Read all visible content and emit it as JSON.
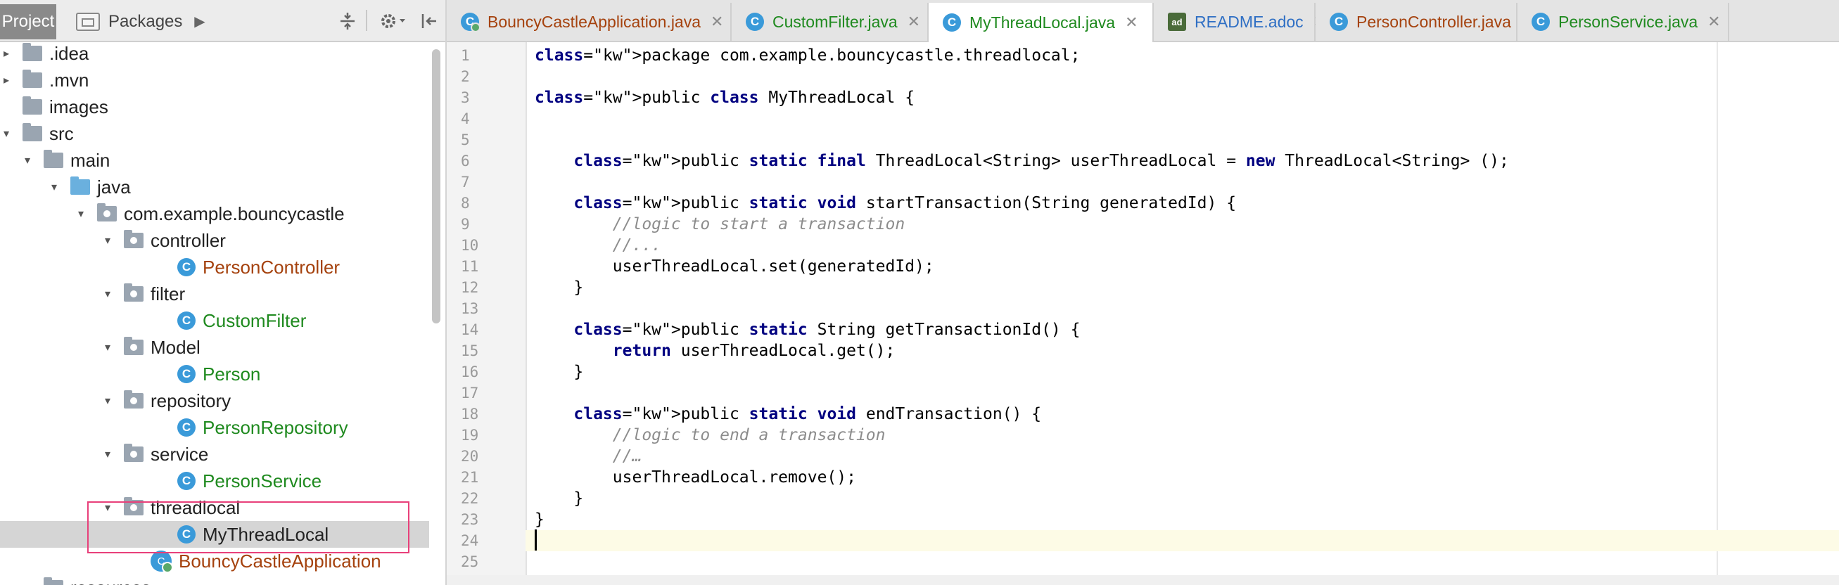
{
  "project_panel": {
    "tab_project": "Project",
    "tab_packages": "Packages",
    "tree": [
      {
        "label": "idea",
        "prefix": ".",
        "kind": "folder",
        "color": "default"
      },
      {
        "label": ".mvn",
        "kind": "folder",
        "color": "default"
      },
      {
        "label": "images",
        "kind": "folder",
        "color": "default"
      },
      {
        "label": "src",
        "kind": "folder",
        "color": "default"
      },
      {
        "label": "main",
        "kind": "folder",
        "color": "default"
      },
      {
        "label": "java",
        "kind": "source-folder",
        "color": "default"
      },
      {
        "label": "com.example.bouncycastle",
        "kind": "package",
        "color": "default"
      },
      {
        "label": "controller",
        "kind": "package",
        "color": "default"
      },
      {
        "label": "PersonController",
        "kind": "class",
        "color": "brown"
      },
      {
        "label": "filter",
        "kind": "package",
        "color": "default"
      },
      {
        "label": "CustomFilter",
        "kind": "class",
        "color": "green"
      },
      {
        "label": "Model",
        "kind": "package",
        "color": "default"
      },
      {
        "label": "Person",
        "kind": "class",
        "color": "green"
      },
      {
        "label": "repository",
        "kind": "package",
        "color": "default"
      },
      {
        "label": "PersonRepository",
        "kind": "class",
        "color": "green"
      },
      {
        "label": "service",
        "kind": "package",
        "color": "default"
      },
      {
        "label": "PersonService",
        "kind": "class",
        "color": "green"
      },
      {
        "label": "threadlocal",
        "kind": "package",
        "color": "default"
      },
      {
        "label": "MyThreadLocal",
        "kind": "class",
        "color": "default",
        "selected": true
      },
      {
        "label": "BouncyCastleApplication",
        "kind": "app-class",
        "color": "brown"
      },
      {
        "label": "resources",
        "kind": "folder",
        "color": "default"
      }
    ]
  },
  "tabs": [
    {
      "label": "BouncyCastleApplication.java",
      "color": "brown",
      "icon": "spring-boot-app-icon",
      "active": false
    },
    {
      "label": "CustomFilter.java",
      "color": "green",
      "icon": "class-icon",
      "active": false
    },
    {
      "label": "MyThreadLocal.java",
      "color": "green",
      "icon": "class-icon",
      "active": true
    },
    {
      "label": "README.adoc",
      "color": "blue",
      "icon": "asciidoc-icon",
      "active": false
    },
    {
      "label": "PersonController.java",
      "color": "brown",
      "icon": "class-icon",
      "active": false
    },
    {
      "label": "PersonService.java",
      "color": "green",
      "icon": "class-icon",
      "active": false
    }
  ],
  "editor": {
    "line_numbers": [
      "1",
      "2",
      "3",
      "4",
      "5",
      "6",
      "7",
      "8",
      "9",
      "10",
      "11",
      "12",
      "13",
      "14",
      "15",
      "16",
      "17",
      "18",
      "19",
      "20",
      "21",
      "22",
      "23",
      "24",
      "25"
    ],
    "lines": [
      "package com.example.bouncycastle.threadlocal;",
      "",
      "public class MyThreadLocal {",
      "",
      "",
      "    public static final ThreadLocal<String> userThreadLocal = new ThreadLocal<String> ();",
      "",
      "    public static void startTransaction(String generatedId) {",
      "        //logic to start a transaction",
      "        //...",
      "        userThreadLocal.set(generatedId);",
      "    }",
      "",
      "    public static String getTransactionId() {",
      "        return userThreadLocal.get();",
      "    }",
      "",
      "    public static void endTransaction() {",
      "        //logic to end a transaction",
      "        //…",
      "        userThreadLocal.remove();",
      "    }",
      "}",
      "",
      ""
    ],
    "keywords": [
      "package",
      "public",
      "class",
      "static",
      "final",
      "new",
      "void",
      "return"
    ]
  },
  "colors": {
    "highlight_box": "#e8407a",
    "keyword": "#000080",
    "comment": "#8c8c8c",
    "green_file": "#1f8a1f",
    "brown_file": "#a5420e",
    "selected_row": "#d5d5d5",
    "caret_line": "#fdfbe6"
  }
}
